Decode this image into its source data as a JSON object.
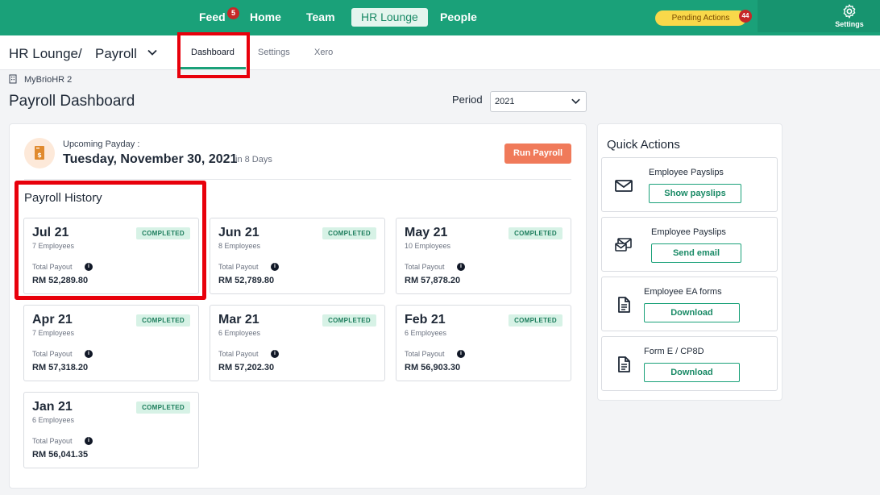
{
  "topnav": {
    "items": [
      {
        "label": "Feed",
        "badge": "5"
      },
      {
        "label": "Home"
      },
      {
        "label": "Team"
      },
      {
        "label": "HR Lounge",
        "active": true
      },
      {
        "label": "People"
      }
    ],
    "pending_label": "Pending Actions",
    "pending_count": "44",
    "settings_label": "Settings"
  },
  "subheader": {
    "crumb_root": "HR Lounge",
    "crumb_sep": "/",
    "crumb_current": "Payroll",
    "tabs": [
      "Dashboard",
      "Settings",
      "Xero"
    ]
  },
  "org": {
    "name": "MyBrioHR 2"
  },
  "page": {
    "title": "Payroll Dashboard",
    "period_label": "Period",
    "period_value": "2021"
  },
  "payday": {
    "label": "Upcoming Payday :",
    "date": "Tuesday, November 30, 2021",
    "in_days": "in 8 Days",
    "run_button": "Run Payroll"
  },
  "history": {
    "title": "Payroll History",
    "total_label": "Total Payout",
    "cards": [
      {
        "month": "Jul 21",
        "employees": "7 Employees",
        "status": "COMPLETED",
        "amount": "RM 52,289.80"
      },
      {
        "month": "Jun 21",
        "employees": "8 Employees",
        "status": "COMPLETED",
        "amount": "RM 52,789.80"
      },
      {
        "month": "May 21",
        "employees": "10 Employees",
        "status": "COMPLETED",
        "amount": "RM 57,878.20"
      },
      {
        "month": "Apr 21",
        "employees": "7 Employees",
        "status": "COMPLETED",
        "amount": "RM 57,318.20"
      },
      {
        "month": "Mar 21",
        "employees": "6 Employees",
        "status": "COMPLETED",
        "amount": "RM 57,202.30"
      },
      {
        "month": "Feb 21",
        "employees": "6 Employees",
        "status": "COMPLETED",
        "amount": "RM 56,903.30"
      },
      {
        "month": "Jan 21",
        "employees": "6 Employees",
        "status": "COMPLETED",
        "amount": "RM 56,041.35"
      }
    ]
  },
  "quick_actions": {
    "title": "Quick Actions",
    "items": [
      {
        "label": "Employee Payslips",
        "button": "Show payslips",
        "icon": "envelope-icon"
      },
      {
        "label": "Employee Payslips",
        "button": "Send email",
        "icon": "send-email-icon"
      },
      {
        "label": "Employee EA forms",
        "button": "Download",
        "icon": "document-icon"
      },
      {
        "label": "Form E / CP8D",
        "button": "Download",
        "icon": "document-icon"
      }
    ]
  },
  "colors": {
    "brand": "#1aa179",
    "run_button": "#f07a5a",
    "highlight": "#e8000b",
    "pending": "#f9d84a"
  }
}
